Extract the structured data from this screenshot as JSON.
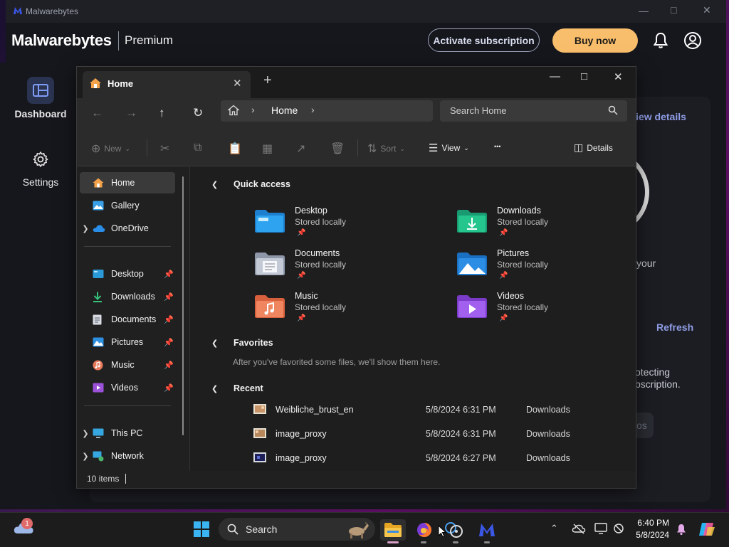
{
  "malwarebytes": {
    "window_title": "Malwarebytes",
    "brand": "Malwarebytes",
    "edition": "Premium",
    "activate_label": "Activate subscription",
    "buy_label": "Buy now",
    "sidebar": [
      {
        "label": "Dashboard",
        "icon": "dashboard-icon"
      },
      {
        "label": "Settings",
        "icon": "gear-icon"
      }
    ],
    "fragments": {
      "view_details": "View details",
      "your": "your",
      "refresh": "Refresh",
      "protecting": "otecting",
      "subscription": "bscription.",
      "os": "os"
    },
    "colors": {
      "buy": "#f9be6b",
      "link": "#8f9de6",
      "brand_blue": "#3b57e6"
    }
  },
  "explorer": {
    "tab_label": "Home",
    "address": {
      "crumb": "Home"
    },
    "search_placeholder": "Search Home",
    "commands": {
      "new": "New",
      "sort": "Sort",
      "view": "View",
      "more": "•••",
      "details": "Details"
    },
    "nav_pane": {
      "top": [
        {
          "label": "Home",
          "icon": "home-icon"
        },
        {
          "label": "Gallery",
          "icon": "gallery-icon"
        },
        {
          "label": "OneDrive",
          "icon": "onedrive-icon"
        }
      ],
      "pinned": [
        {
          "label": "Desktop",
          "icon": "desktop-folder-icon"
        },
        {
          "label": "Downloads",
          "icon": "download-icon"
        },
        {
          "label": "Documents",
          "icon": "documents-icon"
        },
        {
          "label": "Pictures",
          "icon": "pictures-icon"
        },
        {
          "label": "Music",
          "icon": "music-icon"
        },
        {
          "label": "Videos",
          "icon": "videos-icon"
        }
      ],
      "bottom": [
        {
          "label": "This PC",
          "icon": "pc-icon"
        },
        {
          "label": "Network",
          "icon": "network-icon"
        }
      ]
    },
    "quick_access": {
      "title": "Quick access",
      "items": [
        {
          "name": "Desktop",
          "sub": "Stored locally"
        },
        {
          "name": "Downloads",
          "sub": "Stored locally"
        },
        {
          "name": "Documents",
          "sub": "Stored locally"
        },
        {
          "name": "Pictures",
          "sub": "Stored locally"
        },
        {
          "name": "Music",
          "sub": "Stored locally"
        },
        {
          "name": "Videos",
          "sub": "Stored locally"
        }
      ]
    },
    "favorites": {
      "title": "Favorites",
      "note": "After you've favorited some files, we'll show them here."
    },
    "recent": {
      "title": "Recent",
      "rows": [
        {
          "name": "Weibliche_brust_en",
          "date": "5/8/2024 6:31 PM",
          "location": "Downloads"
        },
        {
          "name": "image_proxy",
          "date": "5/8/2024 6:31 PM",
          "location": "Downloads"
        },
        {
          "name": "image_proxy",
          "date": "5/8/2024 6:27 PM",
          "location": "Downloads"
        }
      ]
    },
    "status": "10 items"
  },
  "taskbar": {
    "search_placeholder": "Search",
    "weather_badge": "1",
    "time": "6:40 PM",
    "date": "5/8/2024"
  }
}
